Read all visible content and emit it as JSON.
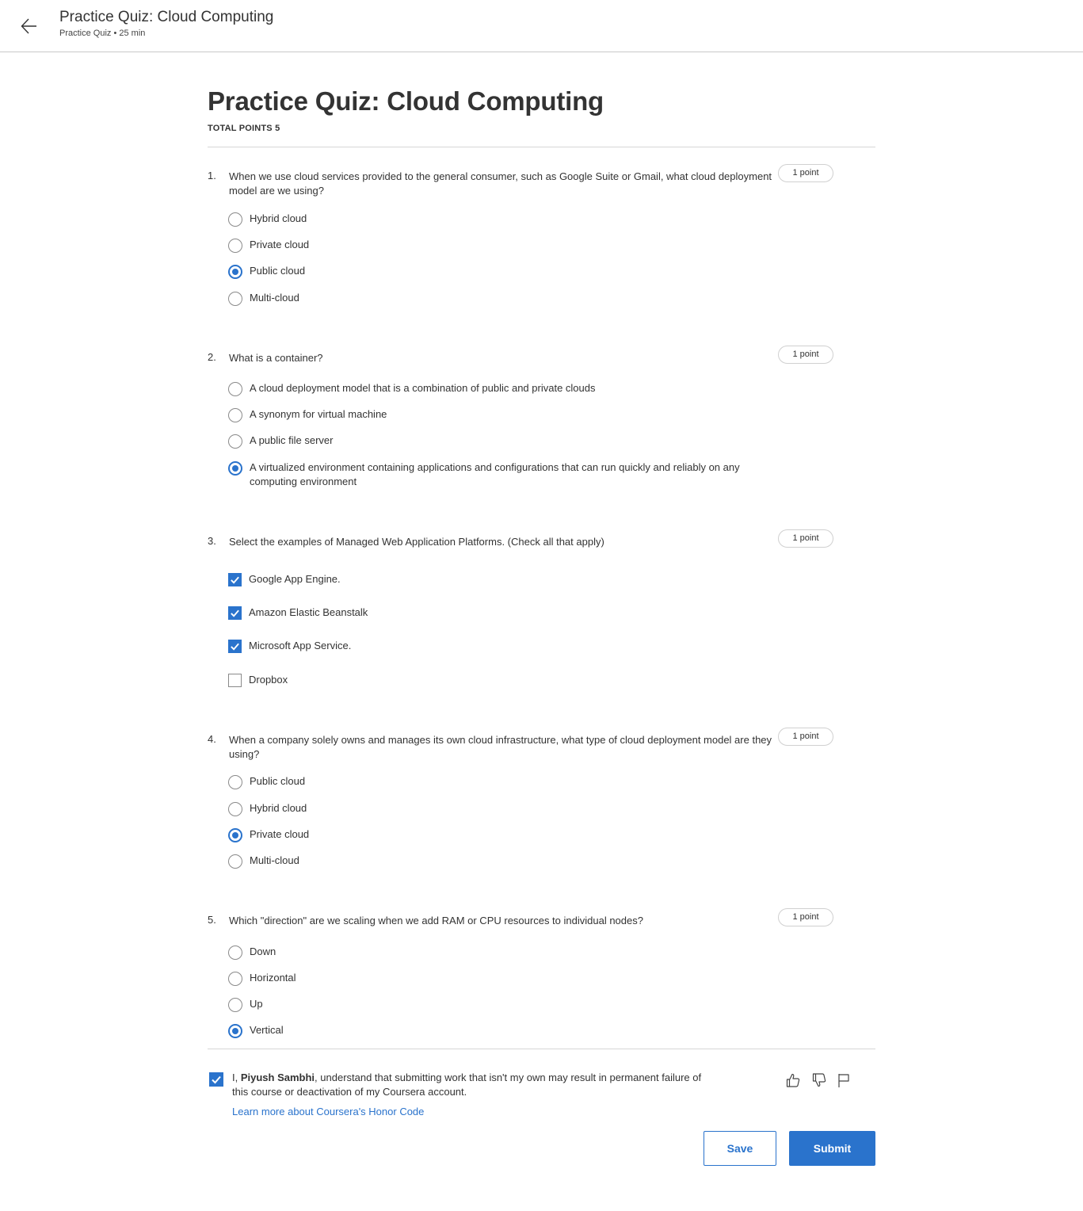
{
  "header": {
    "title": "Practice Quiz: Cloud Computing",
    "subtitle": "Practice Quiz • 25 min"
  },
  "quiz": {
    "title": "Practice Quiz: Cloud Computing",
    "total_points": "TOTAL POINTS 5"
  },
  "questions": [
    {
      "number": "1.",
      "text": "When we use cloud services provided to the general consumer, such as Google Suite or Gmail, what cloud deployment model are we using?",
      "points": "1 point",
      "type": "radio",
      "options": [
        {
          "label": "Hybrid cloud",
          "checked": false
        },
        {
          "label": "Private cloud",
          "checked": false
        },
        {
          "label": "Public cloud",
          "checked": true
        },
        {
          "label": "Multi-cloud",
          "checked": false
        }
      ]
    },
    {
      "number": "2.",
      "text": "What is a container?",
      "points": "1 point",
      "type": "radio",
      "options": [
        {
          "label": "A cloud deployment model that is a combination of public and private clouds",
          "checked": false
        },
        {
          "label": "A synonym for virtual machine",
          "checked": false
        },
        {
          "label": "A public file server",
          "checked": false
        },
        {
          "label": "A virtualized environment containing applications and configurations that can run quickly and reliably on any computing environment",
          "checked": true
        }
      ]
    },
    {
      "number": "3.",
      "text": "Select the examples of Managed Web Application Platforms. (Check all that apply)",
      "points": "1 point",
      "type": "checkbox",
      "options": [
        {
          "label": "Google App Engine.",
          "checked": true
        },
        {
          "label": "Amazon Elastic Beanstalk",
          "checked": true
        },
        {
          "label": "Microsoft App Service.",
          "checked": true
        },
        {
          "label": "Dropbox",
          "checked": false
        }
      ]
    },
    {
      "number": "4.",
      "text": "When a company solely owns and manages its own cloud infrastructure, what type of cloud deployment model are they using?",
      "points": "1 point",
      "type": "radio",
      "options": [
        {
          "label": "Public cloud",
          "checked": false
        },
        {
          "label": "Hybrid cloud",
          "checked": false
        },
        {
          "label": "Private cloud",
          "checked": true
        },
        {
          "label": "Multi-cloud",
          "checked": false
        }
      ]
    },
    {
      "number": "5.",
      "text": "Which \"direction\" are we scaling when we add RAM or CPU resources to individual nodes?",
      "points": "1 point",
      "type": "radio",
      "options": [
        {
          "label": "Down",
          "checked": false
        },
        {
          "label": "Horizontal",
          "checked": false
        },
        {
          "label": "Up",
          "checked": false
        },
        {
          "label": "Vertical",
          "checked": true
        }
      ]
    }
  ],
  "honor": {
    "prefix": "I, ",
    "name": "Piyush Sambhi",
    "suffix": ", understand that submitting work that isn't my own may result in permanent failure of this course or deactivation of my Coursera account.",
    "checked": true,
    "link": "Learn more about Coursera's Honor Code"
  },
  "actions": {
    "save": "Save",
    "submit": "Submit"
  },
  "colors": {
    "accent": "#2a73cc"
  }
}
